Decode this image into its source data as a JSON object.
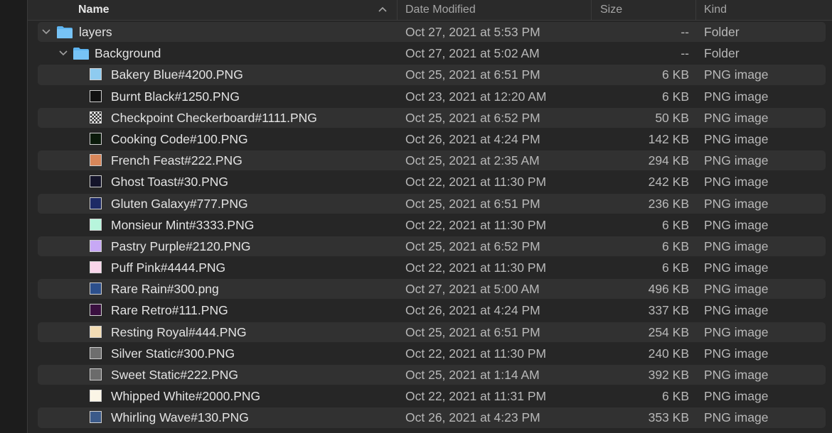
{
  "columns": {
    "name": "Name",
    "date_modified": "Date Modified",
    "size": "Size",
    "kind": "Kind"
  },
  "folders": [
    {
      "name": "layers",
      "date": "Oct 27, 2021 at 5:53 PM",
      "size": "--",
      "kind": "Folder"
    },
    {
      "name": "Background",
      "date": "Oct 27, 2021 at 5:02 AM",
      "size": "--",
      "kind": "Folder"
    }
  ],
  "files": [
    {
      "name": "Bakery Blue#4200.PNG",
      "date": "Oct 25, 2021 at 6:51 PM",
      "size": "6 KB",
      "kind": "PNG image",
      "thumb_color": "#8ecbf0",
      "thumb_icon": "solid-color-thumbnail-icon"
    },
    {
      "name": "Burnt Black#1250.PNG",
      "date": "Oct 23, 2021 at 12:20 AM",
      "size": "6 KB",
      "kind": "PNG image",
      "thumb_color": "#111111",
      "thumb_icon": "solid-color-thumbnail-icon"
    },
    {
      "name": "Checkpoint Checkerboard#1111.PNG",
      "date": "Oct 25, 2021 at 6:52 PM",
      "size": "50 KB",
      "kind": "PNG image",
      "thumb_color": "checker",
      "thumb_icon": "checkerboard-thumbnail-icon"
    },
    {
      "name": "Cooking Code#100.PNG",
      "date": "Oct 26, 2021 at 4:24 PM",
      "size": "142 KB",
      "kind": "PNG image",
      "thumb_color": "#0a1a0a",
      "thumb_icon": "code-thumbnail-icon"
    },
    {
      "name": "French Feast#222.PNG",
      "date": "Oct 25, 2021 at 2:35 AM",
      "size": "294 KB",
      "kind": "PNG image",
      "thumb_color": "#d9875a",
      "thumb_icon": "image-thumbnail-icon"
    },
    {
      "name": "Ghost Toast#30.PNG",
      "date": "Oct 22, 2021 at 11:30 PM",
      "size": "242 KB",
      "kind": "PNG image",
      "thumb_color": "#14142a",
      "thumb_icon": "image-thumbnail-icon"
    },
    {
      "name": "Gluten Galaxy#777.PNG",
      "date": "Oct 25, 2021 at 6:51 PM",
      "size": "236 KB",
      "kind": "PNG image",
      "thumb_color": "#1d2a66",
      "thumb_icon": "image-thumbnail-icon"
    },
    {
      "name": "Monsieur Mint#3333.PNG",
      "date": "Oct 22, 2021 at 11:30 PM",
      "size": "6 KB",
      "kind": "PNG image",
      "thumb_color": "#b7f5dc",
      "thumb_icon": "solid-color-thumbnail-icon"
    },
    {
      "name": "Pastry Purple#2120.PNG",
      "date": "Oct 25, 2021 at 6:52 PM",
      "size": "6 KB",
      "kind": "PNG image",
      "thumb_color": "#c7a8f5",
      "thumb_icon": "solid-color-thumbnail-icon"
    },
    {
      "name": "Puff Pink#4444.PNG",
      "date": "Oct 22, 2021 at 11:30 PM",
      "size": "6 KB",
      "kind": "PNG image",
      "thumb_color": "#f8d5ea",
      "thumb_icon": "solid-color-thumbnail-icon"
    },
    {
      "name": "Rare Rain#300.png",
      "date": "Oct 27, 2021 at 5:00 AM",
      "size": "496 KB",
      "kind": "PNG image",
      "thumb_color": "#2c4f8c",
      "thumb_icon": "image-thumbnail-icon"
    },
    {
      "name": "Rare Retro#111.PNG",
      "date": "Oct 26, 2021 at 4:24 PM",
      "size": "337 KB",
      "kind": "PNG image",
      "thumb_color": "#3a1040",
      "thumb_icon": "image-thumbnail-icon"
    },
    {
      "name": "Resting Royal#444.PNG",
      "date": "Oct 25, 2021 at 6:51 PM",
      "size": "254 KB",
      "kind": "PNG image",
      "thumb_color": "#f3dcb4",
      "thumb_icon": "image-thumbnail-icon"
    },
    {
      "name": "Silver Static#300.PNG",
      "date": "Oct 22, 2021 at 11:30 PM",
      "size": "240 KB",
      "kind": "PNG image",
      "thumb_color": "#6e6e6e",
      "thumb_icon": "static-thumbnail-icon"
    },
    {
      "name": "Sweet Static#222.PNG",
      "date": "Oct 25, 2021 at 1:14 AM",
      "size": "392 KB",
      "kind": "PNG image",
      "thumb_color": "#6b6b6b",
      "thumb_icon": "static-thumbnail-icon"
    },
    {
      "name": "Whipped White#2000.PNG",
      "date": "Oct 22, 2021 at 11:31 PM",
      "size": "6 KB",
      "kind": "PNG image",
      "thumb_color": "#fbf5e6",
      "thumb_icon": "solid-color-thumbnail-icon"
    },
    {
      "name": "Whirling Wave#130.PNG",
      "date": "Oct 26, 2021 at 4:23 PM",
      "size": "353 KB",
      "kind": "PNG image",
      "thumb_color": "#3b5a8a",
      "thumb_icon": "image-thumbnail-icon"
    }
  ],
  "colors": {
    "folder_icon": "#5db4f0",
    "stripe": "#313131",
    "background": "#262626"
  }
}
